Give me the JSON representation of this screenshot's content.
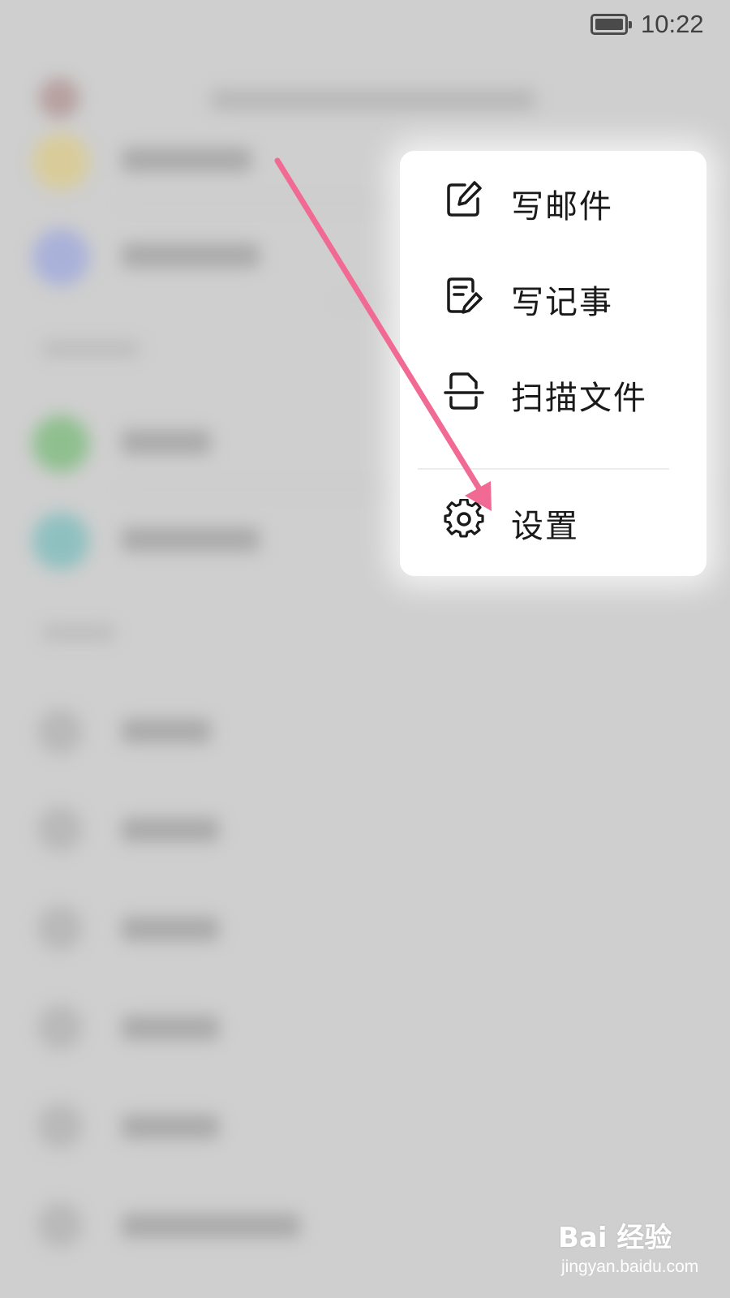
{
  "status_bar": {
    "time": "10:22",
    "battery_icon": "battery-full-icon"
  },
  "menu": {
    "items": [
      {
        "label": "写邮件",
        "icon": "compose-mail-icon"
      },
      {
        "label": "写记事",
        "icon": "write-note-icon"
      },
      {
        "label": "扫描文件",
        "icon": "scan-document-icon"
      },
      {
        "label": "设置",
        "icon": "gear-icon"
      }
    ]
  },
  "annotation": {
    "arrow_color": "#f06a93",
    "points_to": "设置"
  },
  "watermark": {
    "logo_text": "Bai 经验",
    "url": "jingyan.baidu.com"
  },
  "colors": {
    "background": "#cfcfcf",
    "menu_background": "#ffffff",
    "text": "#1a1a1a"
  }
}
